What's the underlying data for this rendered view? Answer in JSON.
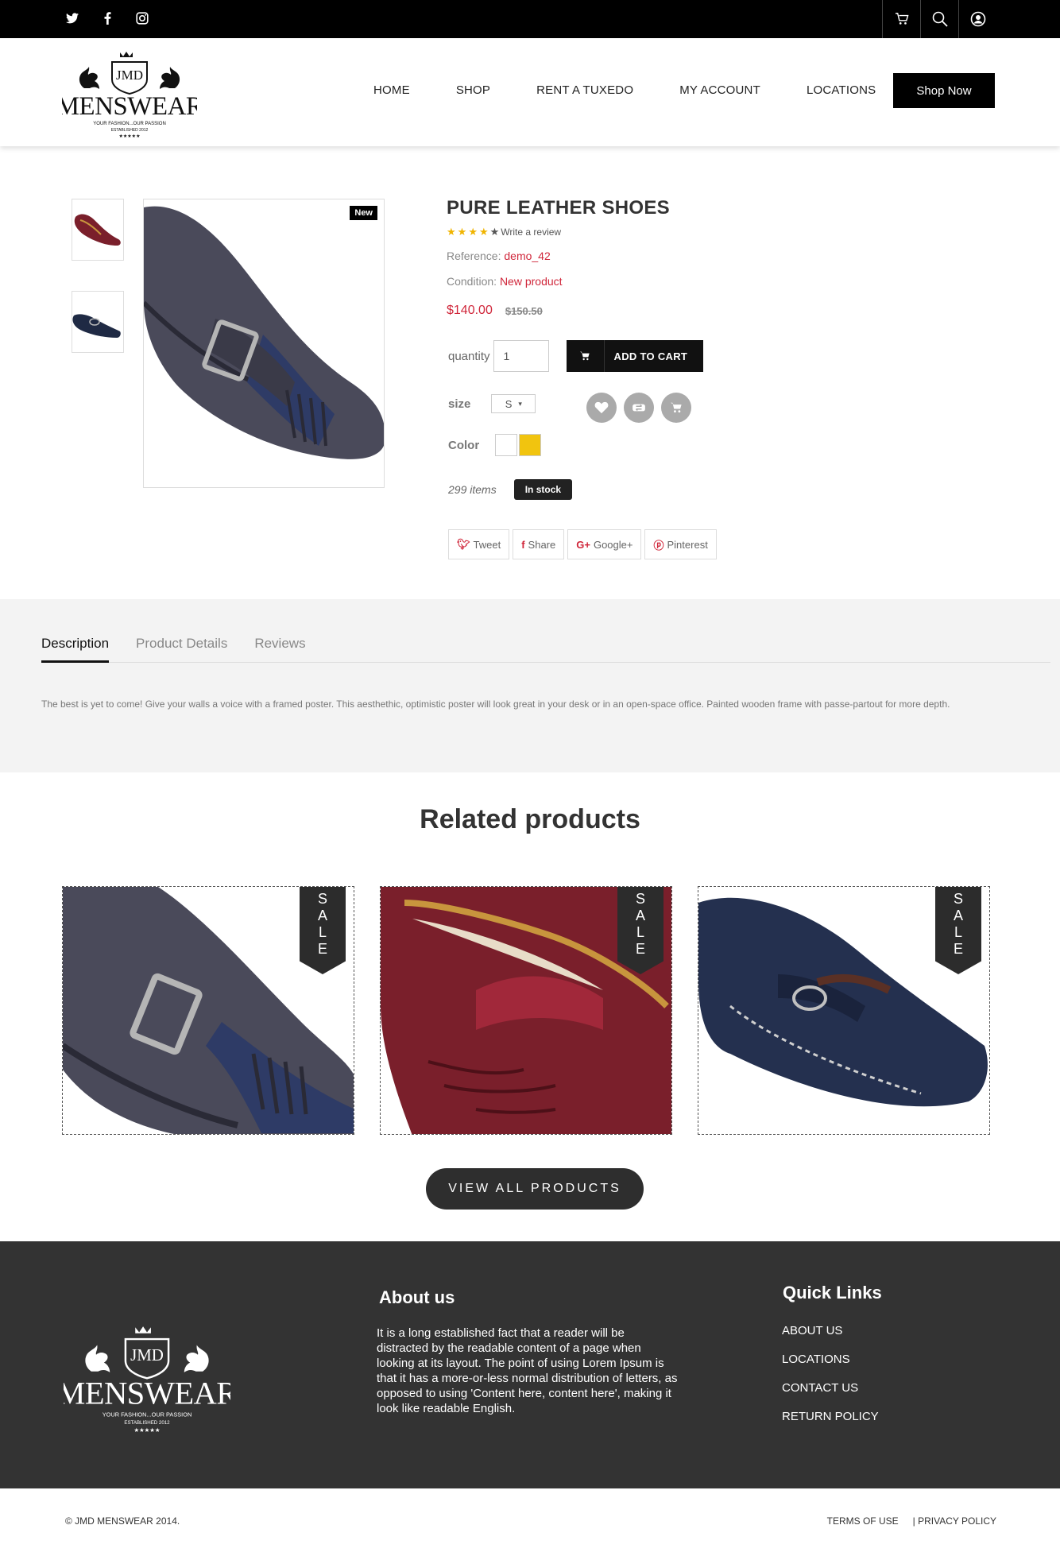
{
  "topbar": {
    "social_icons": [
      "twitter-icon",
      "facebook-icon",
      "instagram-icon"
    ],
    "right_icons": [
      "cart-icon",
      "search-icon",
      "user-icon"
    ]
  },
  "header": {
    "logo": {
      "initials": "JMD",
      "name": "MENSWEAR",
      "tagline": "YOUR FASHION...OUR PASSION",
      "established": "ESTABLISHED 2012"
    },
    "nav": [
      "HOME",
      "SHOP",
      "RENT A TUXEDO",
      "MY ACCOUNT",
      "LOCATIONS"
    ],
    "cta": "Shop Now"
  },
  "product": {
    "badge": "New",
    "title": "PURE LEATHER SHOES",
    "rating": 4,
    "review_link": "Write a review",
    "reference_label": "Reference:",
    "reference": "demo_42",
    "condition_label": "Condition:",
    "condition": "New product",
    "price": "$140.00",
    "old_price": "$150.50",
    "quantity_label": "quantity",
    "quantity": "1",
    "add_to_cart": "ADD TO CART",
    "size_label": "size",
    "size": "S",
    "color_label": "Color",
    "colors": [
      "#ffffff",
      "#f1c40f"
    ],
    "items": "299 items",
    "stock": "In stock",
    "share": [
      {
        "icon": "twitter-icon",
        "label": "Tweet"
      },
      {
        "icon": "facebook-icon",
        "label": "Share"
      },
      {
        "icon": "google-plus-icon",
        "label": "Google+"
      },
      {
        "icon": "pinterest-icon",
        "label": "Pinterest"
      }
    ]
  },
  "tabs": {
    "items": [
      "Description",
      "Product Details",
      "Reviews"
    ],
    "active": "Description",
    "description": "The best is yet to come! Give your walls a voice with a framed poster. This aesthethic, optimistic poster will look great in your desk or in an open-space office. Painted wooden frame with passe-partout for more depth."
  },
  "related": {
    "title": "Related products",
    "sale_label": "SALE",
    "view_all": "VIEW ALL PRODUCTS"
  },
  "footer": {
    "about_title": "About us",
    "about_text": "It is a long established fact that a reader will be distracted by the readable content of a page when looking at its layout. The point of using Lorem Ipsum is that it has a more-or-less normal distribution of letters, as opposed to using 'Content here, content here', making it look like readable English.",
    "quick_links_title": "Quick Links",
    "quick_links": [
      "ABOUT US",
      "LOCATIONS",
      "CONTACT US",
      "RETURN POLICY"
    ],
    "copyright": "© JMD MENSWEAR 2014.",
    "terms": "TERMS OF USE",
    "privacy": "| PRIVACY POLICY"
  },
  "colors": {
    "accent": "#d0263a",
    "dark": "#333333",
    "star": "#f0b400"
  }
}
